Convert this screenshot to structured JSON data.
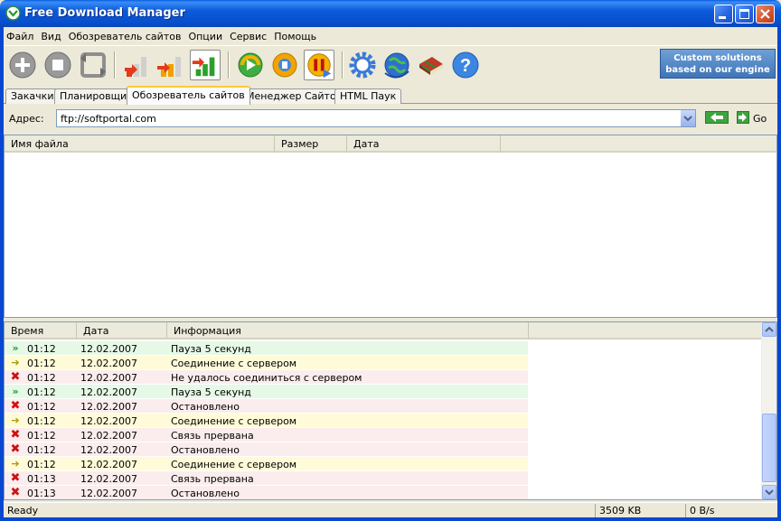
{
  "window": {
    "title": "Free Download Manager",
    "controls": {
      "minimize": "minimize-icon",
      "maximize": "maximize-icon",
      "close": "close-icon"
    }
  },
  "menu": {
    "items": [
      "Файл",
      "Вид",
      "Обозреватель сайтов",
      "Опции",
      "Сервис",
      "Помощь"
    ]
  },
  "toolbar": {
    "buttons": [
      {
        "icon": "add-circle-icon"
      },
      {
        "icon": "stop-circle-icon"
      },
      {
        "icon": "refresh-arrows-icon"
      },
      {
        "icon": "download-low-icon"
      },
      {
        "icon": "download-medium-icon"
      },
      {
        "icon": "download-high-icon"
      },
      {
        "icon": "start-all-icon"
      },
      {
        "icon": "update-icon"
      },
      {
        "icon": "pause-all-icon"
      },
      {
        "icon": "settings-gear-icon"
      },
      {
        "icon": "globe-icon"
      },
      {
        "icon": "book-icon"
      },
      {
        "icon": "help-icon"
      }
    ],
    "banner": "Custom solutions based on our engine"
  },
  "tabs": [
    {
      "label": "Закачки",
      "active": false
    },
    {
      "label": "Планировщик",
      "active": false
    },
    {
      "label": "Обозреватель сайтов",
      "active": true
    },
    {
      "label": "Менеджер Сайтов",
      "active": false
    },
    {
      "label": "HTML Паук",
      "active": false
    }
  ],
  "address": {
    "label": "Адрес:",
    "value": "ftp://softportal.com",
    "go_label": "Go"
  },
  "files": {
    "columns": [
      "Имя файла",
      "Размер",
      "Дата"
    ],
    "rows": []
  },
  "log": {
    "columns": [
      "Время",
      "Дата",
      "Информация"
    ],
    "rows": [
      {
        "severity": "pause",
        "time": "01:12",
        "date": "12.02.2007",
        "message": "Пауза 5 секунд"
      },
      {
        "severity": "info",
        "time": "01:12",
        "date": "12.02.2007",
        "message": "Соединение с сервером"
      },
      {
        "severity": "error",
        "time": "01:12",
        "date": "12.02.2007",
        "message": "Не удалось соединиться с сервером"
      },
      {
        "severity": "pause",
        "time": "01:12",
        "date": "12.02.2007",
        "message": "Пауза 5 секунд"
      },
      {
        "severity": "error",
        "time": "01:12",
        "date": "12.02.2007",
        "message": "Остановлено"
      },
      {
        "severity": "info",
        "time": "01:12",
        "date": "12.02.2007",
        "message": "Соединение с сервером"
      },
      {
        "severity": "error",
        "time": "01:12",
        "date": "12.02.2007",
        "message": "Связь прервана"
      },
      {
        "severity": "error",
        "time": "01:12",
        "date": "12.02.2007",
        "message": "Остановлено"
      },
      {
        "severity": "info",
        "time": "01:12",
        "date": "12.02.2007",
        "message": "Соединение с сервером"
      },
      {
        "severity": "error",
        "time": "01:13",
        "date": "12.02.2007",
        "message": "Связь прервана"
      },
      {
        "severity": "error",
        "time": "01:13",
        "date": "12.02.2007",
        "message": "Остановлено"
      }
    ]
  },
  "status": {
    "text": "Ready",
    "traffic": "3509 KB",
    "speed": "0 B/s"
  }
}
